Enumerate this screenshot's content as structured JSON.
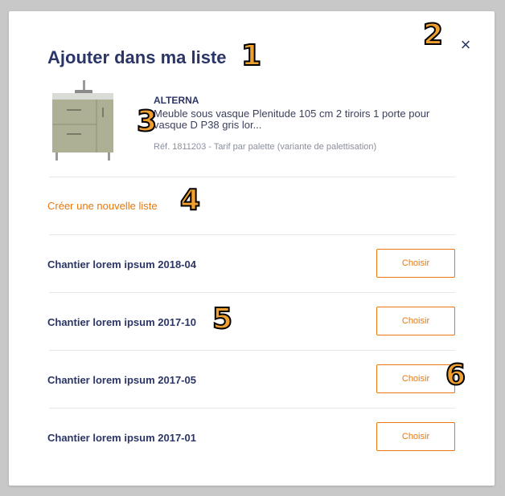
{
  "modal": {
    "title": "Ajouter dans ma liste",
    "close_symbol": "×",
    "close_icon": "close-icon"
  },
  "product": {
    "brand": "ALTERNA",
    "description": "Meuble sous vasque Plenitude 105 cm 2 tiroirs 1 porte pour vasque D P38 gris lor...",
    "reference": "Réf. 1811203 - Tarif par palette (variante de palettisation)",
    "image_icon": "bathroom-cabinet-image"
  },
  "create_list": {
    "label": "Créer une nouvelle liste"
  },
  "lists": [
    {
      "name": "Chantier lorem ipsum 2018-04",
      "button": "Choisir"
    },
    {
      "name": "Chantier lorem ipsum 2017-10",
      "button": "Choisir"
    },
    {
      "name": "Chantier lorem ipsum 2017-05",
      "button": "Choisir"
    },
    {
      "name": "Chantier lorem ipsum 2017-01",
      "button": "Choisir"
    }
  ],
  "annotations": [
    "1",
    "2",
    "3",
    "4",
    "5",
    "6"
  ],
  "colors": {
    "primary": "#2b3566",
    "accent": "#e8780f",
    "muted": "#8b8f9e",
    "backdrop": "#c8c8c8",
    "marker": "#f0a030"
  }
}
